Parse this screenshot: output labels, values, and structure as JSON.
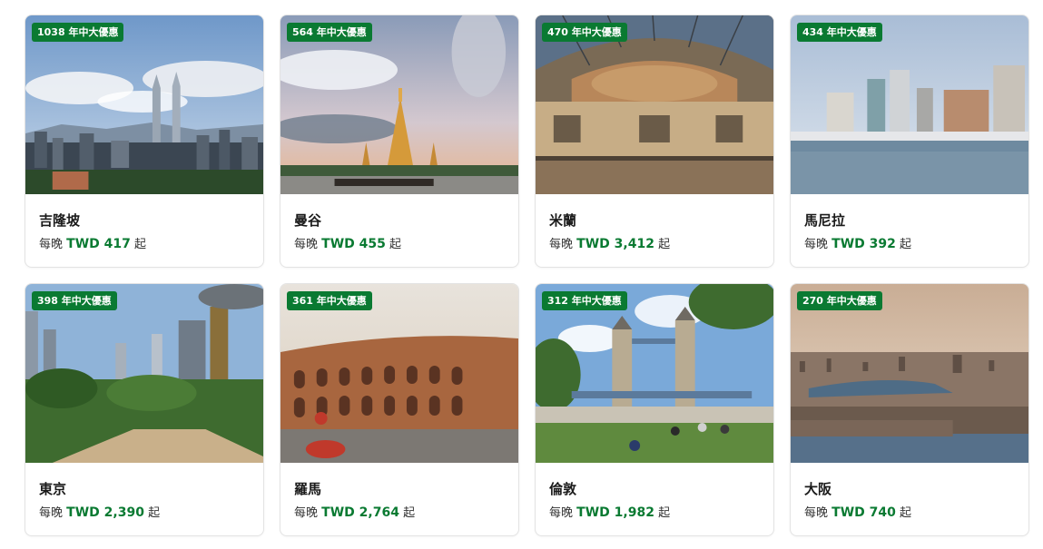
{
  "cards": [
    {
      "deal": "1038 年中大優惠",
      "city": "吉隆坡",
      "prefix": "每晚",
      "currency": "TWD",
      "amount": "417",
      "suffix": "起",
      "scene": "kuala-lumpur-skyline"
    },
    {
      "deal": "564 年中大優惠",
      "city": "曼谷",
      "prefix": "每晚",
      "currency": "TWD",
      "amount": "455",
      "suffix": "起",
      "scene": "bangkok-temple"
    },
    {
      "deal": "470 年中大優惠",
      "city": "米蘭",
      "prefix": "每晚",
      "currency": "TWD",
      "amount": "3,412",
      "suffix": "起",
      "scene": "milan-galleria"
    },
    {
      "deal": "434 年中大優惠",
      "city": "馬尼拉",
      "prefix": "每晚",
      "currency": "TWD",
      "amount": "392",
      "suffix": "起",
      "scene": "manila-marina"
    },
    {
      "deal": "398 年中大優惠",
      "city": "東京",
      "prefix": "每晚",
      "currency": "TWD",
      "amount": "2,390",
      "suffix": "起",
      "scene": "tokyo-park"
    },
    {
      "deal": "361 年中大優惠",
      "city": "羅馬",
      "prefix": "每晚",
      "currency": "TWD",
      "amount": "2,764",
      "suffix": "起",
      "scene": "rome-colosseum"
    },
    {
      "deal": "312 年中大優惠",
      "city": "倫敦",
      "prefix": "每晚",
      "currency": "TWD",
      "amount": "1,982",
      "suffix": "起",
      "scene": "london-tower-bridge"
    },
    {
      "deal": "270 年中大優惠",
      "city": "大阪",
      "prefix": "每晚",
      "currency": "TWD",
      "amount": "740",
      "suffix": "起",
      "scene": "osaka-bay-aerial"
    }
  ],
  "colors": {
    "accent": "#0a7a32",
    "badge_text": "#ffffff",
    "border": "#e3e3e3"
  }
}
